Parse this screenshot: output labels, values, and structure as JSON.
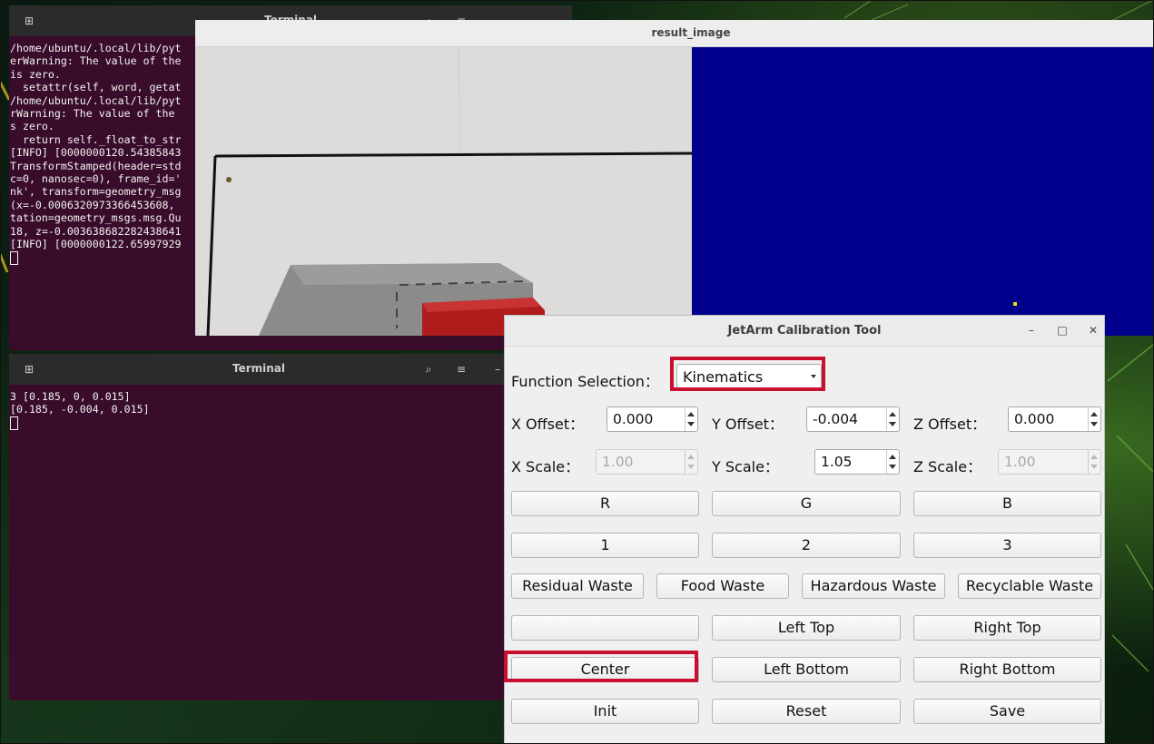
{
  "terminal_top": {
    "title": "Terminal",
    "lines": [
      "/home/ubuntu/.local/lib/pyt",
      "erWarning: The value of the",
      "is zero.",
      "  setattr(self, word, getat",
      "/home/ubuntu/.local/lib/pyt",
      "rWarning: The value of the ",
      "s zero.",
      "  return self._float_to_str",
      "[INFO] [0000000120.54385843",
      "TransformStamped(header=std",
      "c=0, nanosec=0), frame_id='",
      "nk', transform=geometry_msg",
      "(x=-0.0006320973366453608,",
      "tation=geometry_msgs.msg.Qu",
      "18, z=-0.003638682282438641",
      "[INFO] [0000000122.65997929"
    ]
  },
  "terminal_bottom": {
    "title": "Terminal",
    "lines": [
      "3 [0.185, 0, 0.015]",
      "[0.185, -0.004, 0.015]"
    ]
  },
  "result_window": {
    "title": "result_image"
  },
  "calibration_tool": {
    "title": "JetArm Calibration Tool",
    "function_label": "Function Selection：",
    "function_value": "Kinematics",
    "offsets": {
      "x_label": "X Offset：",
      "x_value": "0.000",
      "y_label": "Y Offset：",
      "y_value": "-0.004",
      "z_label": "Z Offset：",
      "z_value": "0.000"
    },
    "scales": {
      "x_label": "X Scale：",
      "x_value": "1.00",
      "y_label": "Y Scale：",
      "y_value": "1.05",
      "z_label": "Z Scale：",
      "z_value": "1.00"
    },
    "color_buttons": [
      "R",
      "G",
      "B"
    ],
    "number_buttons": [
      "1",
      "2",
      "3"
    ],
    "waste_buttons": [
      "Residual Waste",
      "Food Waste",
      "Hazardous Waste",
      "Recyclable Waste"
    ],
    "position_buttons": {
      "blank": "",
      "left_top": "Left Top",
      "right_top": "Right Top",
      "center": "Center",
      "left_bottom": "Left Bottom",
      "right_bottom": "Right Bottom"
    },
    "action_buttons": {
      "init": "Init",
      "reset": "Reset",
      "save": "Save"
    }
  },
  "colors": {
    "terminal_bg": "#380c2a",
    "mask_bg": "#00008c",
    "highlight": "#c8102e"
  },
  "icons": {
    "terminal_new_tab": "new-tab-icon",
    "terminal_search": "search-icon",
    "terminal_menu": "hamburger-menu-icon",
    "window_minimize": "minimize-icon",
    "window_maximize": "maximize-icon",
    "window_close": "close-icon"
  }
}
